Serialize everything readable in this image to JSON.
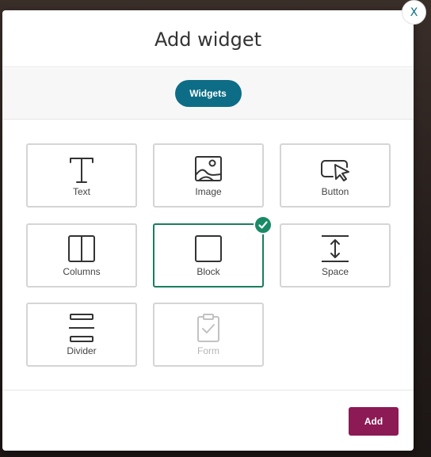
{
  "modal": {
    "title": "Add widget",
    "tab_label": "Widgets",
    "close_label": "X",
    "add_label": "Add"
  },
  "widgets": [
    {
      "label": "Text",
      "icon": "text-icon",
      "state": "normal"
    },
    {
      "label": "Image",
      "icon": "image-icon",
      "state": "normal"
    },
    {
      "label": "Button",
      "icon": "button-cursor-icon",
      "state": "normal"
    },
    {
      "label": "Columns",
      "icon": "columns-icon",
      "state": "normal"
    },
    {
      "label": "Block",
      "icon": "block-icon",
      "state": "selected"
    },
    {
      "label": "Space",
      "icon": "space-icon",
      "state": "normal"
    },
    {
      "label": "Divider",
      "icon": "divider-icon",
      "state": "normal"
    },
    {
      "label": "Form",
      "icon": "clipboard-check-icon",
      "state": "disabled"
    }
  ],
  "colors": {
    "primary_teal": "#0d6d86",
    "selected_green": "#1a7d60",
    "add_button": "#8c1a54",
    "disabled_gray": "#b5b5b5"
  }
}
